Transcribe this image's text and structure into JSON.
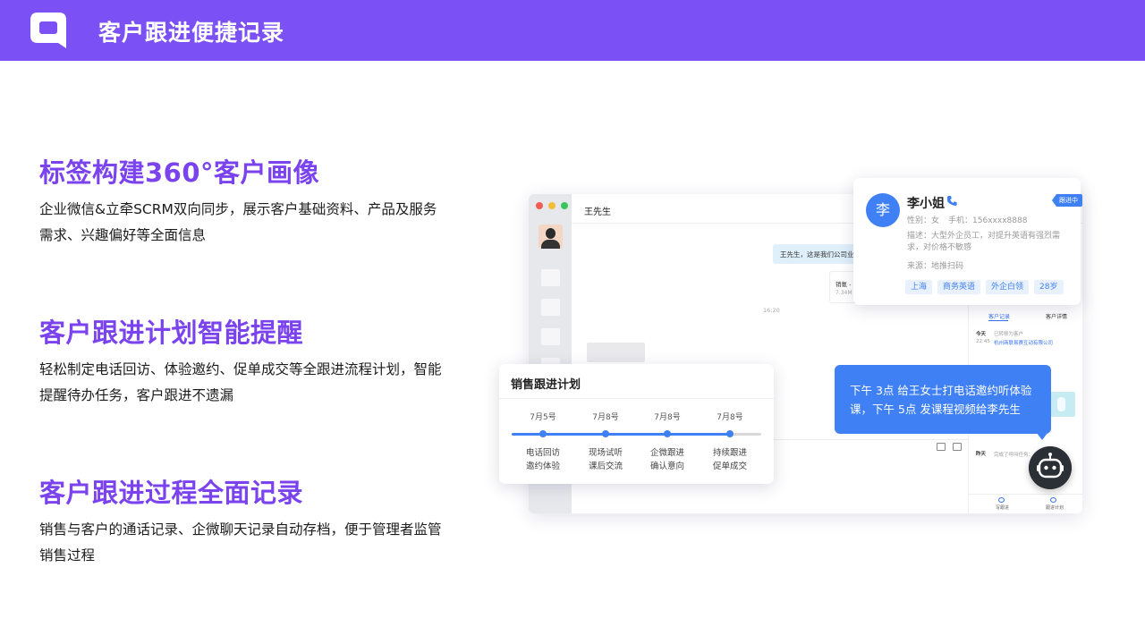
{
  "header": {
    "title": "客户跟进便捷记录"
  },
  "features": [
    {
      "title": "标签构建360°客户画像",
      "desc_line1": "企业微信&立牵SCRM双向同步，展示客户基础资料、产品及服务",
      "desc_line2": "需求、兴趣偏好等全面信息"
    },
    {
      "title": "客户跟进计划智能提醒",
      "desc_line1": "轻松制定电话回访、体验邀约、促单成交等全跟进流程计划，智能",
      "desc_line2": "提醒待办任务，客户跟进不遗漏"
    },
    {
      "title": "客户跟进过程全面记录",
      "desc_line1": "销售与客户的通话记录、企微聊天记录自动存档，便于管理者监管",
      "desc_line2": "销售过程"
    }
  ],
  "chat": {
    "contact_name": "王先生",
    "bubble_text": "王先生，这是我们公司业",
    "card_title": "销氪 -",
    "card_sub": "7.34M",
    "timestamp": "16:20"
  },
  "detail_panel": {
    "tab_records": "客户记录",
    "tab_details": "客户详情",
    "day_today": "今天",
    "time1": "22:45",
    "rec1_title": "已转移为客户",
    "rec1_company": "杭州商联易赛互动有限公司",
    "day_yesterday": "昨天",
    "rec2_title": "完成了呼叫任务：",
    "foot_left": "写跟进",
    "foot_right": "跟进计划"
  },
  "customer": {
    "avatar_char": "李",
    "name": "李小姐",
    "status_ribbon": "跟进中",
    "gender_label": "性别：",
    "gender": "女",
    "phone_label": "手机：",
    "phone": "156xxxx8888",
    "desc_label": "描述：",
    "desc": "大型外企员工，对提升英语有强烈需求，对价格不敏感",
    "source_label": "来源：",
    "source": "地推扫码",
    "tags": [
      "上海",
      "商务英语",
      "外企白领",
      "28岁"
    ]
  },
  "plan": {
    "title": "销售跟进计划",
    "steps": [
      {
        "date": "7月5号",
        "line1": "电话回访",
        "line2": "邀约体验"
      },
      {
        "date": "7月8号",
        "line1": "现场试听",
        "line2": "课后交流"
      },
      {
        "date": "7月8号",
        "line1": "企微跟进",
        "line2": "确认意向"
      },
      {
        "date": "7月8号",
        "line1": "持续跟进",
        "line2": "促单成交"
      }
    ]
  },
  "reminder": {
    "line1": "下午 3点 给王女士打电话邀约听体验",
    "line2": "课，下午 5点 发课程视频给李先生"
  },
  "colors": {
    "brand_purple": "#7b50f4",
    "title_purple": "#7a43ee",
    "accent_blue": "#3f80f5"
  }
}
